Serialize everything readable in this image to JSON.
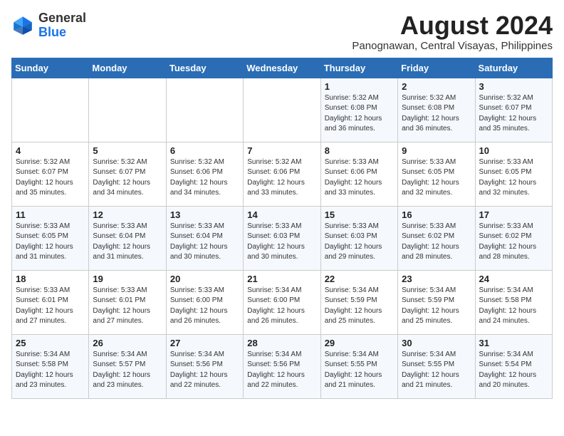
{
  "logo": {
    "general": "General",
    "blue": "Blue"
  },
  "header": {
    "month_year": "August 2024",
    "location": "Panognawan, Central Visayas, Philippines"
  },
  "weekdays": [
    "Sunday",
    "Monday",
    "Tuesday",
    "Wednesday",
    "Thursday",
    "Friday",
    "Saturday"
  ],
  "weeks": [
    [
      {
        "day": "",
        "info": ""
      },
      {
        "day": "",
        "info": ""
      },
      {
        "day": "",
        "info": ""
      },
      {
        "day": "",
        "info": ""
      },
      {
        "day": "1",
        "info": "Sunrise: 5:32 AM\nSunset: 6:08 PM\nDaylight: 12 hours\nand 36 minutes."
      },
      {
        "day": "2",
        "info": "Sunrise: 5:32 AM\nSunset: 6:08 PM\nDaylight: 12 hours\nand 36 minutes."
      },
      {
        "day": "3",
        "info": "Sunrise: 5:32 AM\nSunset: 6:07 PM\nDaylight: 12 hours\nand 35 minutes."
      }
    ],
    [
      {
        "day": "4",
        "info": "Sunrise: 5:32 AM\nSunset: 6:07 PM\nDaylight: 12 hours\nand 35 minutes."
      },
      {
        "day": "5",
        "info": "Sunrise: 5:32 AM\nSunset: 6:07 PM\nDaylight: 12 hours\nand 34 minutes."
      },
      {
        "day": "6",
        "info": "Sunrise: 5:32 AM\nSunset: 6:06 PM\nDaylight: 12 hours\nand 34 minutes."
      },
      {
        "day": "7",
        "info": "Sunrise: 5:32 AM\nSunset: 6:06 PM\nDaylight: 12 hours\nand 33 minutes."
      },
      {
        "day": "8",
        "info": "Sunrise: 5:33 AM\nSunset: 6:06 PM\nDaylight: 12 hours\nand 33 minutes."
      },
      {
        "day": "9",
        "info": "Sunrise: 5:33 AM\nSunset: 6:05 PM\nDaylight: 12 hours\nand 32 minutes."
      },
      {
        "day": "10",
        "info": "Sunrise: 5:33 AM\nSunset: 6:05 PM\nDaylight: 12 hours\nand 32 minutes."
      }
    ],
    [
      {
        "day": "11",
        "info": "Sunrise: 5:33 AM\nSunset: 6:05 PM\nDaylight: 12 hours\nand 31 minutes."
      },
      {
        "day": "12",
        "info": "Sunrise: 5:33 AM\nSunset: 6:04 PM\nDaylight: 12 hours\nand 31 minutes."
      },
      {
        "day": "13",
        "info": "Sunrise: 5:33 AM\nSunset: 6:04 PM\nDaylight: 12 hours\nand 30 minutes."
      },
      {
        "day": "14",
        "info": "Sunrise: 5:33 AM\nSunset: 6:03 PM\nDaylight: 12 hours\nand 30 minutes."
      },
      {
        "day": "15",
        "info": "Sunrise: 5:33 AM\nSunset: 6:03 PM\nDaylight: 12 hours\nand 29 minutes."
      },
      {
        "day": "16",
        "info": "Sunrise: 5:33 AM\nSunset: 6:02 PM\nDaylight: 12 hours\nand 28 minutes."
      },
      {
        "day": "17",
        "info": "Sunrise: 5:33 AM\nSunset: 6:02 PM\nDaylight: 12 hours\nand 28 minutes."
      }
    ],
    [
      {
        "day": "18",
        "info": "Sunrise: 5:33 AM\nSunset: 6:01 PM\nDaylight: 12 hours\nand 27 minutes."
      },
      {
        "day": "19",
        "info": "Sunrise: 5:33 AM\nSunset: 6:01 PM\nDaylight: 12 hours\nand 27 minutes."
      },
      {
        "day": "20",
        "info": "Sunrise: 5:33 AM\nSunset: 6:00 PM\nDaylight: 12 hours\nand 26 minutes."
      },
      {
        "day": "21",
        "info": "Sunrise: 5:34 AM\nSunset: 6:00 PM\nDaylight: 12 hours\nand 26 minutes."
      },
      {
        "day": "22",
        "info": "Sunrise: 5:34 AM\nSunset: 5:59 PM\nDaylight: 12 hours\nand 25 minutes."
      },
      {
        "day": "23",
        "info": "Sunrise: 5:34 AM\nSunset: 5:59 PM\nDaylight: 12 hours\nand 25 minutes."
      },
      {
        "day": "24",
        "info": "Sunrise: 5:34 AM\nSunset: 5:58 PM\nDaylight: 12 hours\nand 24 minutes."
      }
    ],
    [
      {
        "day": "25",
        "info": "Sunrise: 5:34 AM\nSunset: 5:58 PM\nDaylight: 12 hours\nand 23 minutes."
      },
      {
        "day": "26",
        "info": "Sunrise: 5:34 AM\nSunset: 5:57 PM\nDaylight: 12 hours\nand 23 minutes."
      },
      {
        "day": "27",
        "info": "Sunrise: 5:34 AM\nSunset: 5:56 PM\nDaylight: 12 hours\nand 22 minutes."
      },
      {
        "day": "28",
        "info": "Sunrise: 5:34 AM\nSunset: 5:56 PM\nDaylight: 12 hours\nand 22 minutes."
      },
      {
        "day": "29",
        "info": "Sunrise: 5:34 AM\nSunset: 5:55 PM\nDaylight: 12 hours\nand 21 minutes."
      },
      {
        "day": "30",
        "info": "Sunrise: 5:34 AM\nSunset: 5:55 PM\nDaylight: 12 hours\nand 21 minutes."
      },
      {
        "day": "31",
        "info": "Sunrise: 5:34 AM\nSunset: 5:54 PM\nDaylight: 12 hours\nand 20 minutes."
      }
    ]
  ]
}
